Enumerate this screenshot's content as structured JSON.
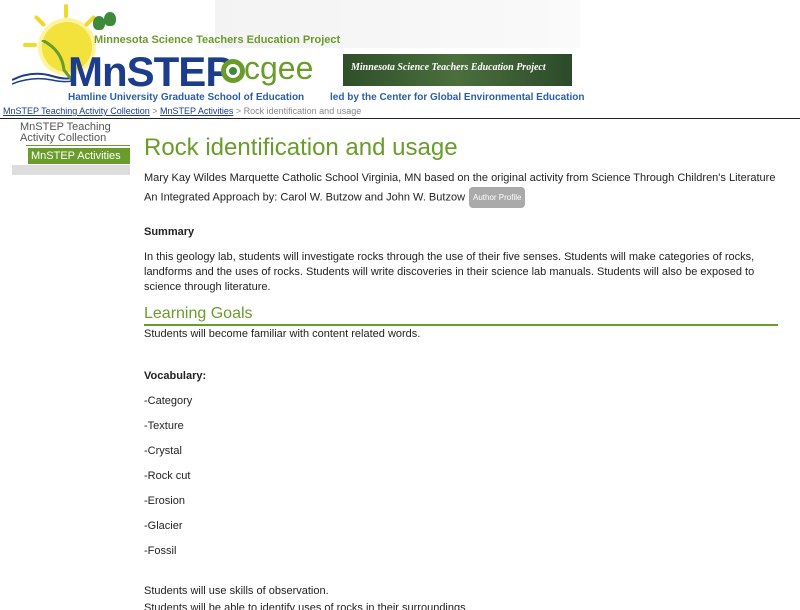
{
  "header": {
    "project_title": "Minnesota Science Teachers Education Project",
    "logo_text": "MnSTEP",
    "university": "Hamline University Graduate School of Education",
    "cgee_text": "cgee",
    "banner_text": "Minnesota Science Teachers Education Project",
    "led_by": "led by the Center for Global Environmental Education"
  },
  "breadcrumb": {
    "item1": "MnSTEP Teaching Activity Collection",
    "sep1": " > ",
    "item2": "MnSTEP Activities",
    "sep2": " > ",
    "current": "Rock identification and usage"
  },
  "sidebar": {
    "item1": "MnSTEP Teaching Activity Collection",
    "item2": "MnSTEP Activities"
  },
  "main": {
    "title": "Rock identification and usage",
    "author_text": "Mary Kay Wildes Marquette Catholic School Virginia, MN based on the original activity from Science Through Children's Literature An Integrated Approach by: Carol W. Butzow and John W. Butzow",
    "author_badge": "Author Profile",
    "summary_heading": "Summary",
    "summary_text": "In this geology lab, students will investigate rocks through the use of their five senses. Students will make categories of rocks, landforms and the uses of rocks. Students will write discoveries in their science lab manuals. Students will also be exposed to science through literature.",
    "learning_heading": "Learning Goals",
    "learning_text": "Students will become familiar with content related words.",
    "vocab_heading": "Vocabulary:",
    "vocab": [
      "-Category",
      "-Texture",
      "-Crystal",
      "-Rock cut",
      "-Erosion",
      "-Glacier",
      "-Fossil"
    ],
    "skills_text": "Students will use skills of observation.",
    "partial_text": "Students will be able to identify uses of rocks in their surroundings."
  },
  "colors": {
    "accent": "#6a9c2c",
    "brand": "#1c3c8c"
  }
}
